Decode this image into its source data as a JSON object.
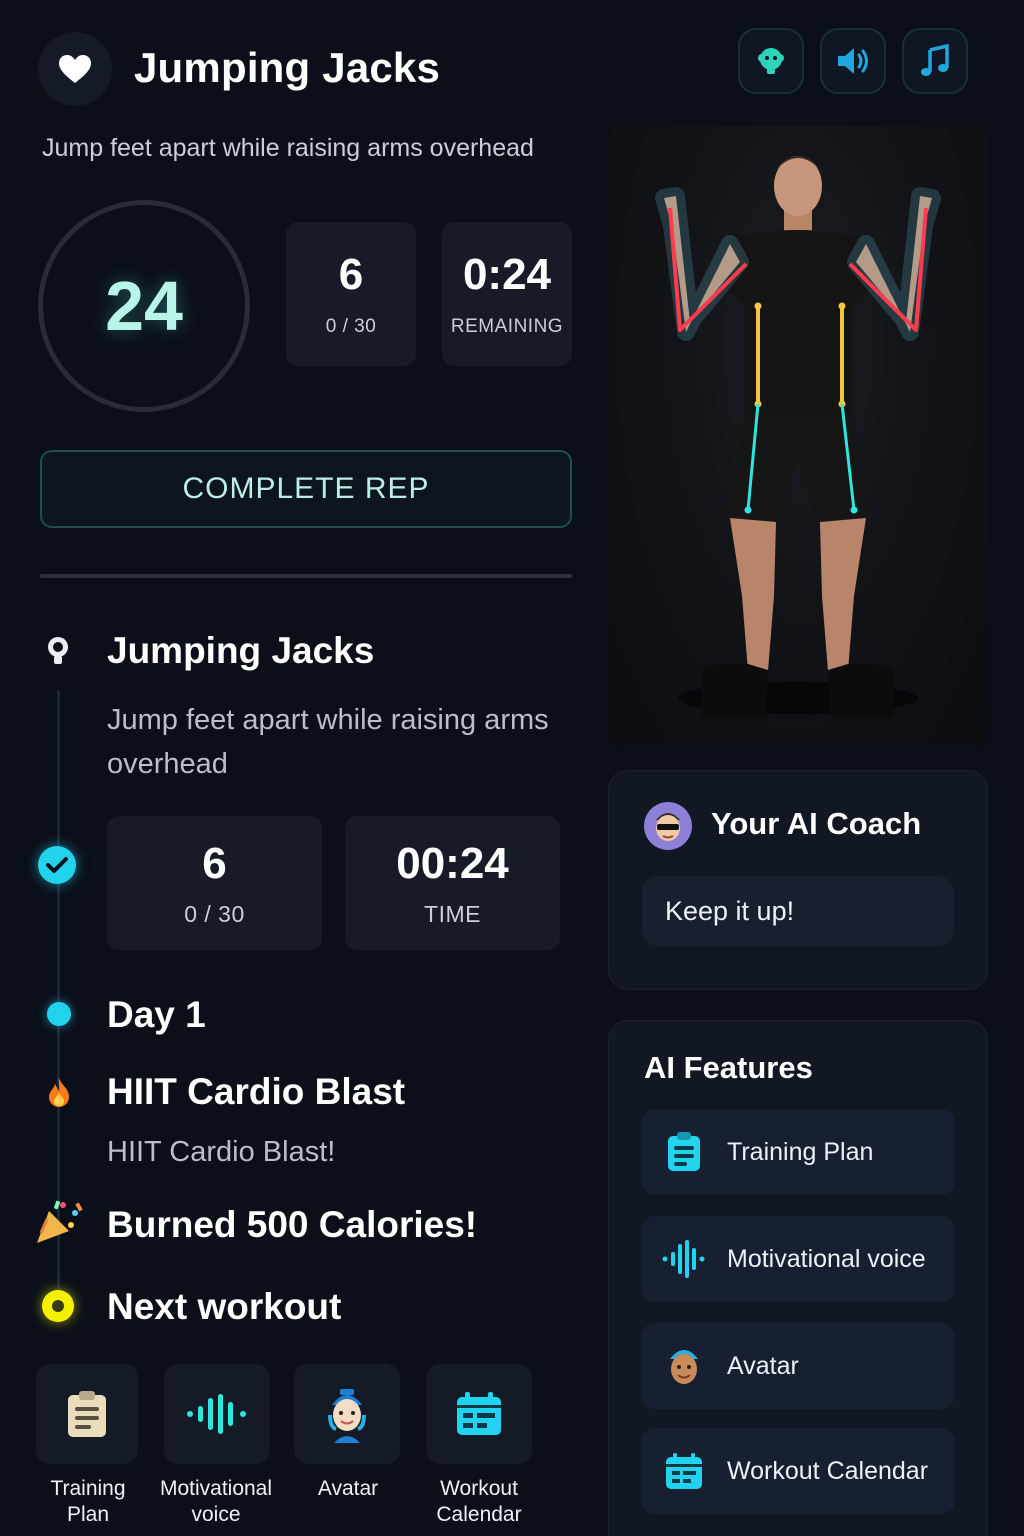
{
  "header": {
    "title": "Jumping Jacks",
    "subtitle": "Jump feet apart while raising arms overhead",
    "icons": [
      "heart-icon",
      "avatar-toggle-icon",
      "speaker-icon",
      "music-icon"
    ]
  },
  "counter": {
    "value": "24"
  },
  "stats": {
    "reps": {
      "value": "6",
      "label": "0 / 30"
    },
    "remaining": {
      "value": "0:24",
      "label": "REMAINING"
    }
  },
  "complete_button": "COMPLETE REP",
  "timeline": {
    "exercise": {
      "title": "Jumping Jacks",
      "description": "Jump feet apart while raising arms overhead",
      "reps": {
        "value": "6",
        "label": "0 / 30"
      },
      "time": {
        "value": "00:24",
        "label": "TIME"
      }
    },
    "day": "Day 1",
    "workout": {
      "title": "HIIT Cardio Blast",
      "text": "HIIT Cardio Blast!"
    },
    "achievement": "Burned 500 Calories!",
    "next": "Next workout"
  },
  "tiles": [
    {
      "line1": "Training",
      "line2": "Plan",
      "icon": "clipboard-icon"
    },
    {
      "line1": "Motivational",
      "line2": "voice",
      "icon": "voice-wave-icon"
    },
    {
      "line1": "Avatar",
      "line2": "",
      "icon": "avatar-icon"
    },
    {
      "line1": "Workout",
      "line2": "Calendar",
      "icon": "calendar-icon"
    }
  ],
  "coach": {
    "title": "Your AI Coach",
    "message": "Keep it up!"
  },
  "features": {
    "title": "AI Features",
    "items": [
      {
        "label": "Training Plan",
        "icon": "clipboard-icon"
      },
      {
        "label": "Motivational voice",
        "icon": "voice-wave-icon"
      },
      {
        "label": "Avatar",
        "icon": "avatar-icon"
      },
      {
        "label": "Workout Calendar",
        "icon": "calendar-icon"
      }
    ]
  },
  "colors": {
    "background": "#0b0f1a",
    "accent_cyan": "#22d3ee",
    "accent_mint": "#b9f4ea",
    "pose_red": "#ff3b4e",
    "pose_yellow": "#f5c542",
    "pose_cyan": "#2ee6e0"
  }
}
